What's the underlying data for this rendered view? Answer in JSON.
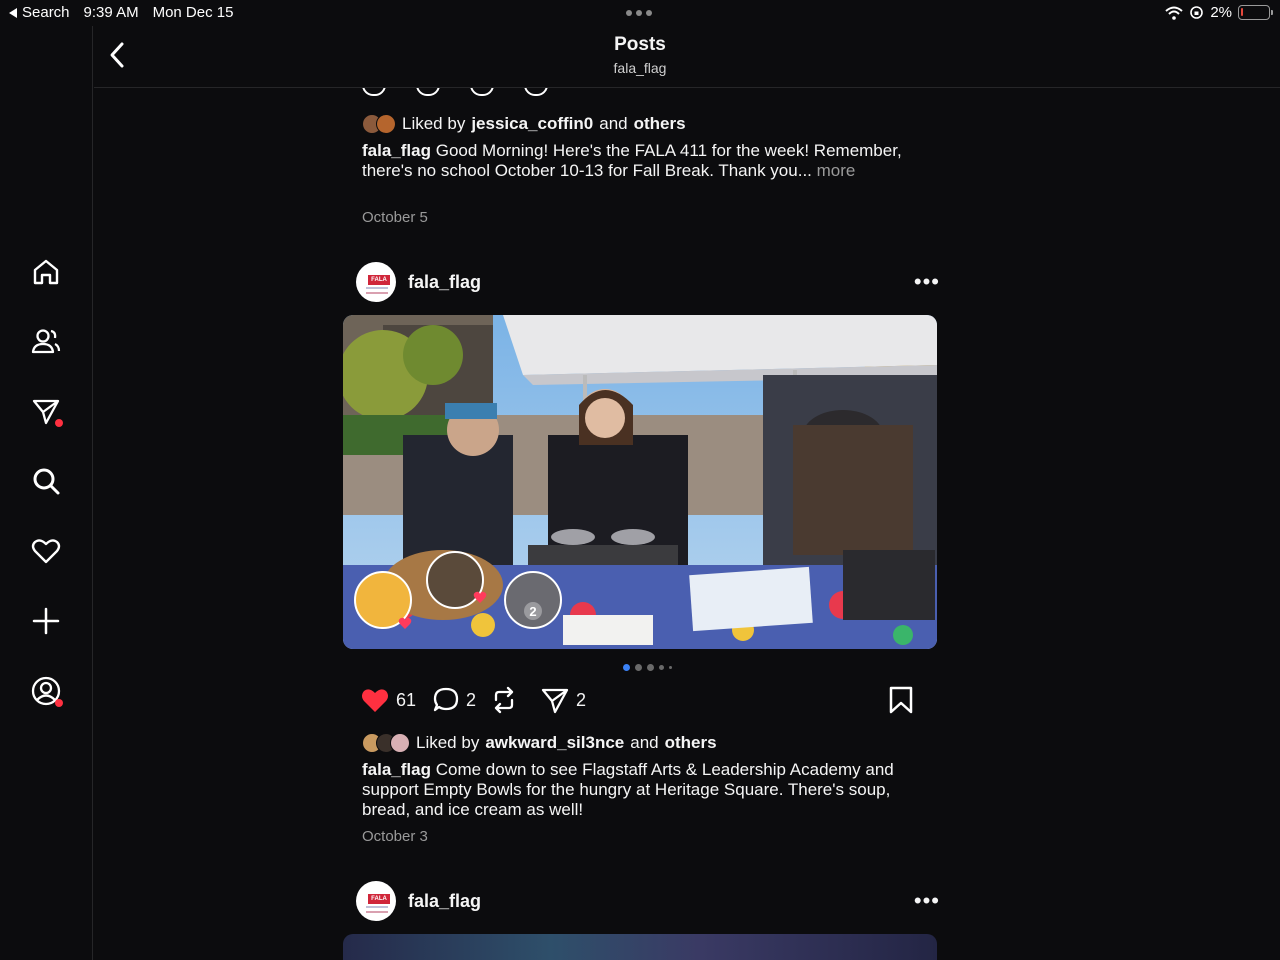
{
  "status_bar": {
    "back_label": "Search",
    "time": "9:39 AM",
    "date": "Mon Dec 15",
    "battery": "2%",
    "battery_level": 0.02
  },
  "header": {
    "title": "Posts",
    "subtitle": "fala_flag"
  },
  "sidebar": {
    "items": [
      {
        "name": "home",
        "icon": "home-icon"
      },
      {
        "name": "following",
        "icon": "users-icon"
      },
      {
        "name": "messages",
        "icon": "send-icon",
        "badge": true
      },
      {
        "name": "search",
        "icon": "search-icon"
      },
      {
        "name": "activity",
        "icon": "heart-icon"
      },
      {
        "name": "create",
        "icon": "plus-icon"
      },
      {
        "name": "profile",
        "icon": "profile-icon",
        "badge": true
      }
    ]
  },
  "post_top": {
    "liked_prefix": "Liked by",
    "liked_user": "jessica_coffin0",
    "liked_and": "and",
    "liked_others": "others",
    "caption_user": "fala_flag",
    "caption_text": "Good Morning! Here's the FALA 411 for the week! Remember, there's no school October 10-13 for Fall Break. Thank you...",
    "more": "more",
    "date": "October 5"
  },
  "post_main": {
    "username": "fala_flag",
    "avatar_text": "FALA",
    "photo_alt": "Empty Bowls event at Heritage Square",
    "tag_count": "2",
    "carousel_total": 5,
    "carousel_active": 0,
    "likes": "61",
    "comments": "2",
    "shares": "2",
    "liked_prefix": "Liked by",
    "liked_user": "awkward_sil3nce",
    "liked_and": "and",
    "liked_others": "others",
    "caption_user": "fala_flag",
    "caption_text": "Come down to see Flagstaff Arts & Leadership Academy and support Empty Bowls for the hungry at Heritage Square. There's soup, bread, and ice cream as well!",
    "date": "October 3"
  },
  "post_next": {
    "username": "fala_flag",
    "avatar_text": "FALA"
  },
  "colors": {
    "background": "#0c0c0e",
    "like_red": "#ff3040",
    "muted": "#9a9a9a",
    "carousel_active": "#3b82f6"
  }
}
